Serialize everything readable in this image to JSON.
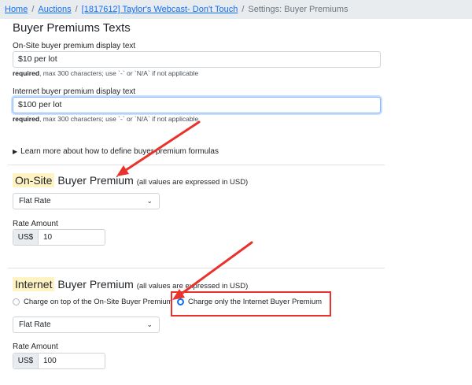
{
  "breadcrumb": {
    "items": [
      "Home",
      "Auctions",
      "[1817612] Taylor's Webcast- Don't Touch"
    ],
    "current": "Settings: Buyer Premiums",
    "separator": "/"
  },
  "texts_section": {
    "title": "Buyer Premiums Texts",
    "onsite_label": "On-Site buyer premium display text",
    "onsite_value": "$10 per lot",
    "onsite_hint_required": "required",
    "onsite_hint_rest": ", max 300 characters; use `-` or `N/A` if not applicable",
    "internet_label": "Internet buyer premium display text",
    "internet_value": "$100 per lot",
    "internet_hint_required": "required",
    "internet_hint_rest": ", max 300 characters; use `-` or `N/A` if not applicable"
  },
  "learn_more": {
    "marker": "▶",
    "label": "Learn more about how to define buyer premium formulas"
  },
  "onsite_bp": {
    "highlight": "On-Site",
    "title": "Buyer Premium",
    "note": "(all values are expressed in USD)",
    "type_value": "Flat Rate",
    "rate_label": "Rate Amount",
    "currency": "US$",
    "rate_value": "10"
  },
  "internet_bp": {
    "highlight": "Internet",
    "title": "Buyer Premium",
    "note": "(all values are expressed in USD)",
    "option_on_top": "Charge on top of the On-Site Buyer Premium",
    "option_only": "Charge only the Internet Buyer Premium",
    "selected_option": "Charge only the Internet Buyer Premium",
    "type_value": "Flat Rate",
    "rate_label": "Rate Amount",
    "currency": "US$",
    "rate_value": "100"
  },
  "icons": {
    "chevron": "chevron-down-icon",
    "arrow": "annotation-arrow-icon"
  },
  "colors": {
    "link": "#0d6efd",
    "highlight": "#fff3c4",
    "annotation": "#e8322b",
    "radio_selected": "#0d6efd"
  }
}
